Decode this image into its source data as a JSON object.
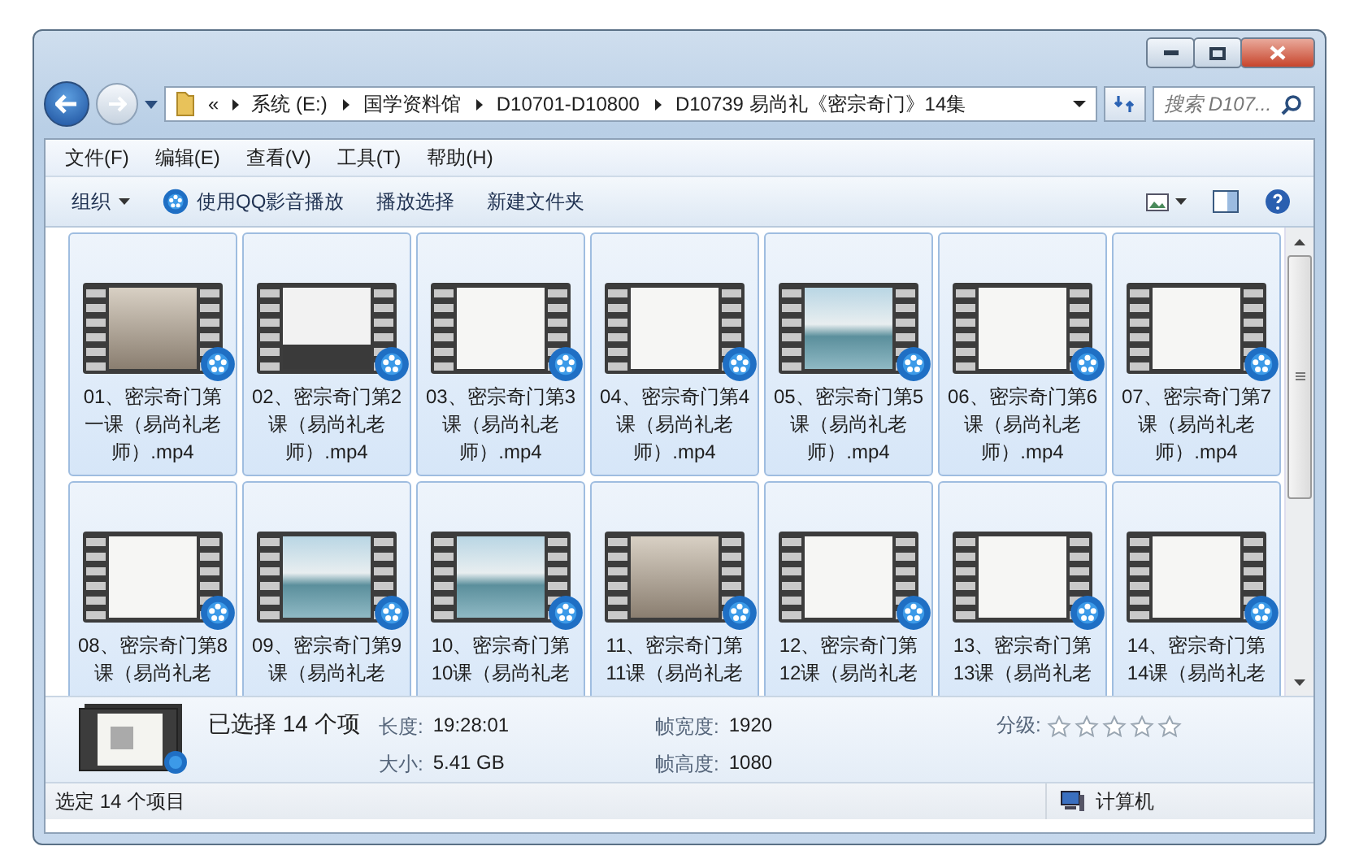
{
  "address_bar": {
    "overflow": "«",
    "path": [
      "系统 (E:)",
      "国学资料馆",
      "D10701-D10800",
      "D10739 易尚礼《密宗奇门》14集"
    ]
  },
  "search": {
    "placeholder": "搜索 D107..."
  },
  "menu": [
    "文件(F)",
    "编辑(E)",
    "查看(V)",
    "工具(T)",
    "帮助(H)"
  ],
  "toolbar": [
    {
      "label": "组织",
      "kind": "dropdown"
    },
    {
      "label": "使用QQ影音播放",
      "kind": "player"
    },
    {
      "label": "播放选择",
      "kind": "plain"
    },
    {
      "label": "新建文件夹",
      "kind": "plain"
    }
  ],
  "files": [
    {
      "lines": [
        "01、密宗奇门第",
        "一课（易尚礼老",
        "师）.mp4"
      ],
      "selected": true,
      "kind": "person"
    },
    {
      "lines": [
        "02、密宗奇门第2",
        "课（易尚礼老",
        "师）.mp4"
      ],
      "selected": true,
      "kind": "dark-screen"
    },
    {
      "lines": [
        "03、密宗奇门第3",
        "课（易尚礼老",
        "师）.mp4"
      ],
      "selected": true,
      "kind": "screen"
    },
    {
      "lines": [
        "04、密宗奇门第4",
        "课（易尚礼老",
        "师）.mp4"
      ],
      "selected": true,
      "kind": "screen"
    },
    {
      "lines": [
        "05、密宗奇门第5",
        "课（易尚礼老",
        "师）.mp4"
      ],
      "selected": true,
      "kind": "landscape"
    },
    {
      "lines": [
        "06、密宗奇门第6",
        "课（易尚礼老",
        "师）.mp4"
      ],
      "selected": true,
      "kind": "screen"
    },
    {
      "lines": [
        "07、密宗奇门第7",
        "课（易尚礼老",
        "师）.mp4"
      ],
      "selected": true,
      "kind": "screen"
    },
    {
      "lines": [
        "08、密宗奇门第8",
        "课（易尚礼老"
      ],
      "selected": true,
      "kind": "screen"
    },
    {
      "lines": [
        "09、密宗奇门第9",
        "课（易尚礼老"
      ],
      "selected": true,
      "kind": "landscape"
    },
    {
      "lines": [
        "10、密宗奇门第",
        "10课（易尚礼老"
      ],
      "selected": true,
      "kind": "landscape"
    },
    {
      "lines": [
        "11、密宗奇门第",
        "11课（易尚礼老"
      ],
      "selected": true,
      "kind": "person"
    },
    {
      "lines": [
        "12、密宗奇门第",
        "12课（易尚礼老"
      ],
      "selected": true,
      "kind": "screen"
    },
    {
      "lines": [
        "13、密宗奇门第",
        "13课（易尚礼老"
      ],
      "selected": true,
      "kind": "screen"
    },
    {
      "lines": [
        "14、密宗奇门第",
        "14课（易尚礼老"
      ],
      "selected": true,
      "kind": "screen"
    }
  ],
  "details": {
    "summary": "已选择 14 个项",
    "fields": [
      {
        "label": "长度:",
        "value": "19:28:01"
      },
      {
        "label": "帧宽度:",
        "value": "1920"
      },
      {
        "label": "大小:",
        "value": "5.41 GB"
      },
      {
        "label": "帧高度:",
        "value": "1080"
      }
    ],
    "rating": {
      "label": "分级:",
      "stars": 0
    }
  },
  "status_bar": {
    "text": "选定 14 个项目",
    "location": "计算机"
  }
}
